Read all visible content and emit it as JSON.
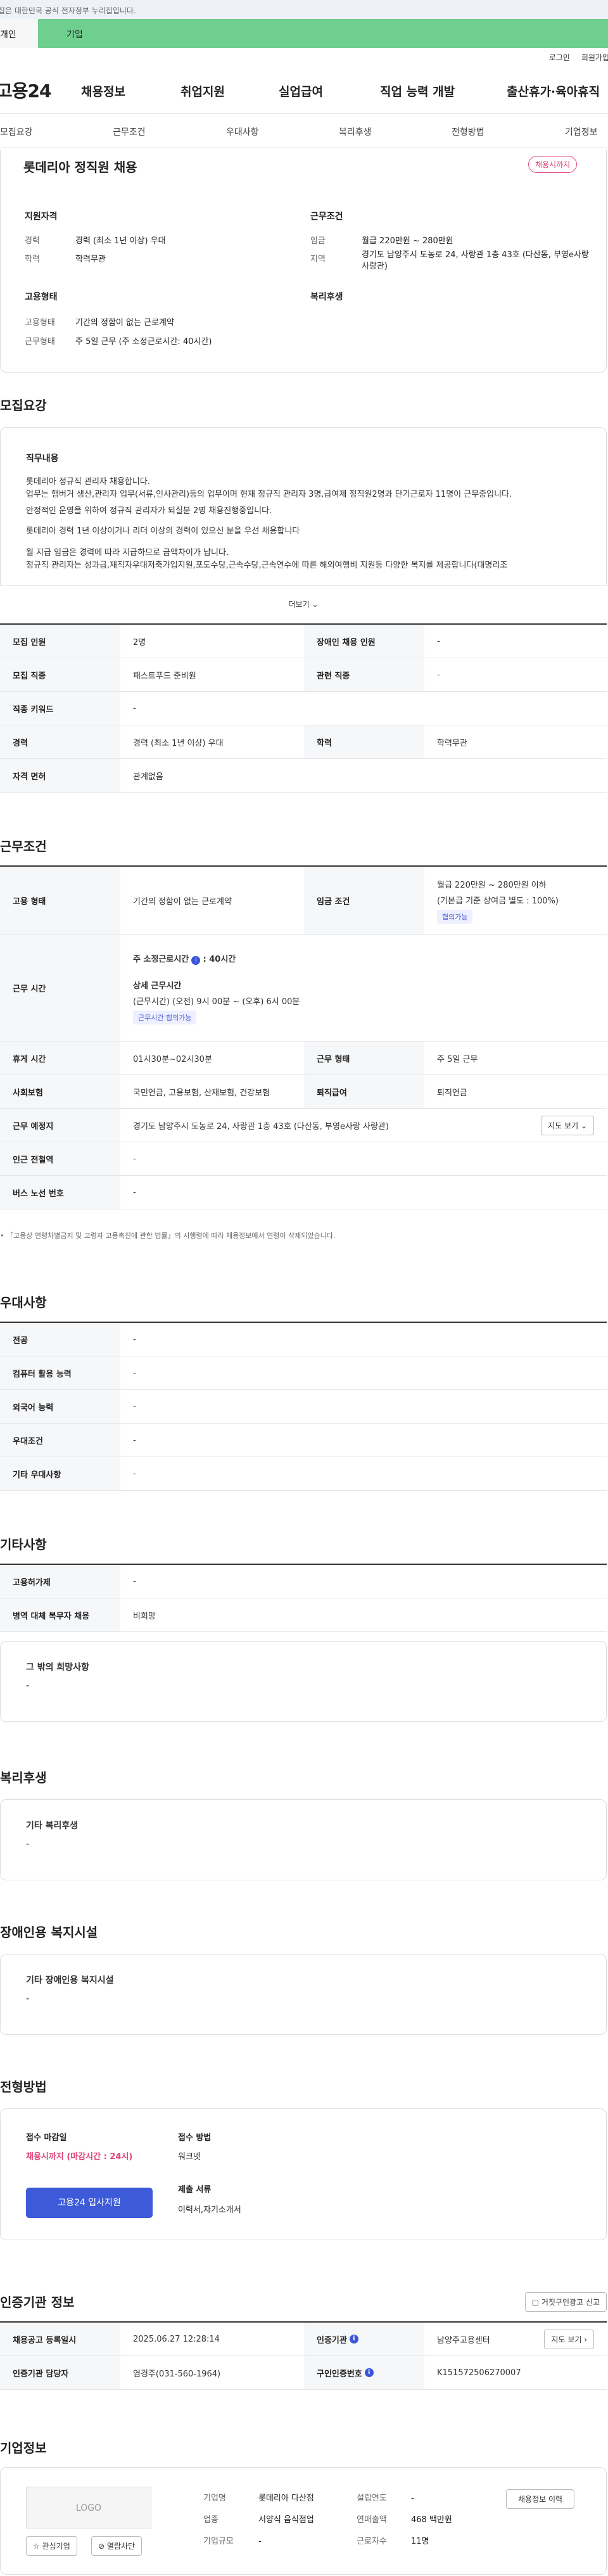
{
  "gov_banner": "이 누리집은 대한민국 공식 전자정부 누리집입니다.",
  "userbar": {
    "personal": "개인",
    "company": "기업"
  },
  "util": {
    "login": "로그인",
    "join": "회원가입"
  },
  "logo": "고용24",
  "gnb": [
    "채용정보",
    "취업지원",
    "실업급여",
    "직업 능력 개발",
    "출산휴가·육아휴직"
  ],
  "tabs": [
    "모집요강",
    "근무조건",
    "우대사항",
    "복리후생",
    "전형방법",
    "기업정보"
  ],
  "summary": {
    "title": "롯데리아 정직원 채용",
    "badge": "채용시까지",
    "qual_h": "지원자격",
    "exp_l": "경력",
    "exp_v": "경력 (최소 1년 이상) 우대",
    "edu_l": "학력",
    "edu_v": "학력무관",
    "cond_h": "근무조건",
    "wage_l": "임금",
    "wage_v": "월급 220만원 ~ 280만원",
    "area_l": "지역",
    "area_v": "경기도 남양주시 도농로 24, 사랑관 1층 43호 (다산동, 부영e사랑 사랑관)",
    "emp_h": "고용형태",
    "type_l": "고용형태",
    "type_v": "기간의 정함이 없는 근로계약",
    "hours_l": "근무형태",
    "hours_v": "주 5일 근무 (주 소정근로시간: 40시간)",
    "welfare_h": "복리후생"
  },
  "recruit": {
    "title": "모집요강",
    "job_h": "직무내용",
    "lines": [
      "롯데리아 정규직 관리자 채용합니다.",
      "업무는 햄버거 생산,관리자 업무(서류,인사관리)등의 업무이며 현재 정규직 관리자 3명,급여제 정직원2명과 단기근로자 11명이 근무중입니다.",
      "안정적인 운영을 위하여 정규직 관리자가 되실분 2명 채용진행중입니다.",
      "롯데리아 경력 1년 이상이거나 리더 이상의 경력이 있으신 분을 우선 채용합니다",
      "월 지급 임금은 경력에 따라 지급하므로 금액차이가 납니다.",
      "정규직 관리자는 성과급,재직자우대저축가입지원,포도수당,근속수당,근속연수에 따른 해외여행비 지원등 다양한 복지를 제공합니다(대명리조"
    ],
    "more": "더보기",
    "rows": [
      [
        "모집 인원",
        "2명",
        "장애인 채용 인원",
        "-"
      ],
      [
        "모집 직종",
        "패스트푸드 준비원",
        "관련 직종",
        "-"
      ],
      [
        "직종 키워드",
        "-"
      ],
      [
        "경력",
        "경력 (최소 1년 이상) 우대",
        "학력",
        "학력무관"
      ],
      [
        "자격 면허",
        "관계없음"
      ]
    ]
  },
  "work": {
    "title": "근무조건",
    "type_l": "고용 형태",
    "type_v": "기간의 정함이 없는 근로계약",
    "wage_l": "임금 조건",
    "wage_v": "월급 220만원 ~ 280만원 이하",
    "wage_sub": "(기본급 기준 상여금 별도 : 100%)",
    "wage_tag": "협의가능",
    "time_l": "근무 시간",
    "time_main": "주 소정근로시간",
    "time_main_v": ": 40시간",
    "time_detail_h": "상세 근무시간",
    "time_detail": "(근무시간) (오전) 9시 00분 ~ (오후) 6시 00분",
    "time_tag": "근무시간 협의가능",
    "rows": [
      [
        "휴게 시간",
        "01시30분~02시30분",
        "근무 형태",
        "주 5일 근무"
      ],
      [
        "사회보험",
        "국민연금, 고용보험, 산재보험, 건강보험",
        "퇴직급여",
        "퇴직연금"
      ]
    ],
    "place_l": "근무 예정지",
    "place_v": "경기도 남양주시 도농로 24, 사랑관 1층 43호 (다산동, 부영e사랑 사랑관)",
    "map_btn": "지도 보기",
    "station_l": "인근 전철역",
    "station_v": "-",
    "bus_l": "버스 노선 번호",
    "bus_v": "-",
    "note": "「고용상 연령차별금지 및 고령자 고용촉진에 관한 법률」의 시행령에 따라 채용정보에서 연령이 삭제되었습니다."
  },
  "pref": {
    "title": "우대사항",
    "rows": [
      [
        "전공",
        "-"
      ],
      [
        "컴퓨터 활용 능력",
        "-"
      ],
      [
        "외국어 능력",
        "-"
      ],
      [
        "우대조건",
        "-"
      ],
      [
        "기타 우대사항",
        "-"
      ]
    ]
  },
  "etc": {
    "title": "기타사항",
    "rows": [
      [
        "고용허가제",
        "-"
      ],
      [
        "병역 대체 복무자 채용",
        "비희망"
      ]
    ],
    "wish_h": "그 밖의 희망사항",
    "wish_v": "-"
  },
  "welfare": {
    "title": "복리후생",
    "h": "기타 복리후생",
    "v": "-"
  },
  "disab": {
    "title": "장애인용 복지시설",
    "h": "기타 장애인용 복지시설",
    "v": "-"
  },
  "select": {
    "title": "전형방법",
    "deadline_h": "접수 마감일",
    "deadline_v": "채용시까지 (마감시간 : 24시)",
    "apply_btn": "고용24 입사지원",
    "method_h": "접수 방법",
    "method_v": "워크넷",
    "docs_h": "제출 서류",
    "docs_v": "이력서,자기소개서"
  },
  "cert": {
    "title": "인증기관 정보",
    "report_btn": "거짓구인광고 신고",
    "rows": [
      [
        "채용공고 등록일시",
        "2025.06.27 12:28:14",
        "인증기관",
        "남양주고용센터"
      ],
      [
        "인증기관 담당자",
        "염경주(031-560-1964)",
        "구인인증번호",
        "K151572506270007"
      ]
    ],
    "map_btn": "지도 보기"
  },
  "company": {
    "title": "기업정보",
    "logo": "LOGO",
    "fav_btn": "관심기업",
    "block_btn": "열람차단",
    "info_btn": "채용정보 이력",
    "rows": [
      [
        "기업명",
        "롯데리아 다산점",
        "설립연도",
        "-"
      ],
      [
        "업종",
        "서양식 음식점업",
        "연매출액",
        "468 백만원"
      ],
      [
        "기업규모",
        "-",
        "근로자수",
        "11명"
      ]
    ]
  }
}
